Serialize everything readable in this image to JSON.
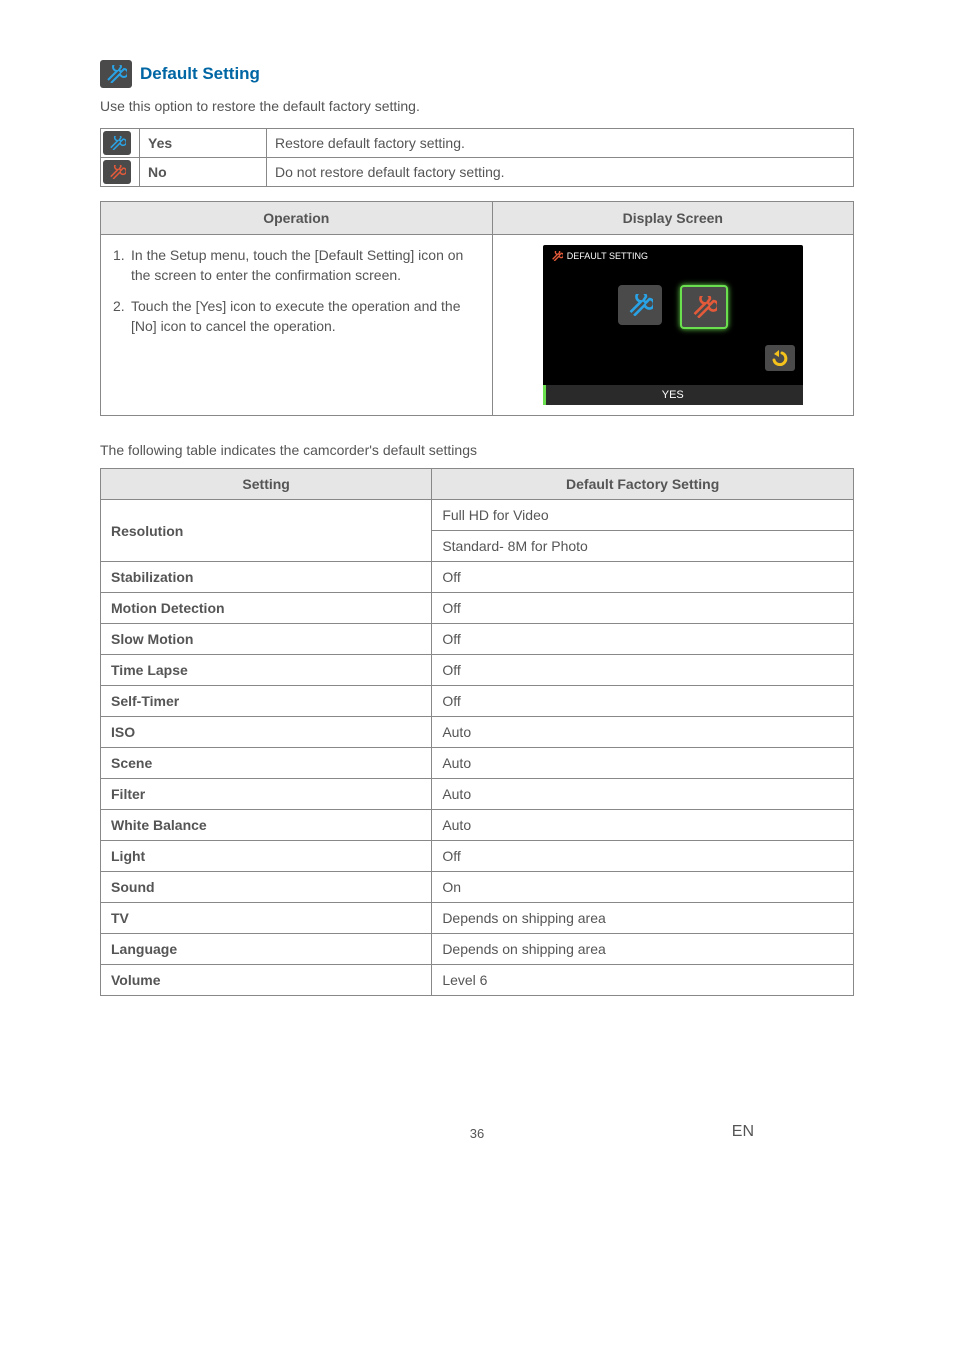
{
  "heading": {
    "title": "Default Setting"
  },
  "intro": "Use this option to restore the default factory setting.",
  "yn": {
    "yes": {
      "label": "Yes",
      "desc": "Restore default factory setting."
    },
    "no": {
      "label": "No",
      "desc": "Do not restore default factory setting."
    }
  },
  "opdisp": {
    "col1": "Operation",
    "col2": "Display Screen",
    "steps": [
      "In the Setup menu, touch the [Default Setting] icon on the screen to enter the confirmation screen.",
      "Touch the [Yes] icon to execute the operation and the [No] icon to cancel the operation."
    ],
    "mock": {
      "title": "DEFAULT SETTING",
      "yes_bar": "YES"
    }
  },
  "table_intro": "The following table indicates the camcorder's default settings",
  "defaults": {
    "col1": "Setting",
    "col2": "Default Factory Setting",
    "rows": [
      {
        "setting": "Resolution",
        "value": "Full HD for Video",
        "rowspan": 2
      },
      {
        "setting": "",
        "value": "Standard- 8M for Photo",
        "continuation": true
      },
      {
        "setting": "Stabilization",
        "value": "Off"
      },
      {
        "setting": "Motion Detection",
        "value": "Off"
      },
      {
        "setting": "Slow Motion",
        "value": "Off"
      },
      {
        "setting": "Time Lapse",
        "value": "Off"
      },
      {
        "setting": "Self-Timer",
        "value": "Off"
      },
      {
        "setting": "ISO",
        "value": "Auto"
      },
      {
        "setting": "Scene",
        "value": "Auto"
      },
      {
        "setting": "Filter",
        "value": "Auto"
      },
      {
        "setting": "White Balance",
        "value": "Auto"
      },
      {
        "setting": "Light",
        "value": "Off"
      },
      {
        "setting": "Sound",
        "value": "On"
      },
      {
        "setting": "TV",
        "value": "Depends on shipping area"
      },
      {
        "setting": "Language",
        "value": "Depends on shipping area"
      },
      {
        "setting": "Volume",
        "value": "Level 6"
      }
    ]
  },
  "footer": {
    "page": "36",
    "lang": "EN"
  }
}
